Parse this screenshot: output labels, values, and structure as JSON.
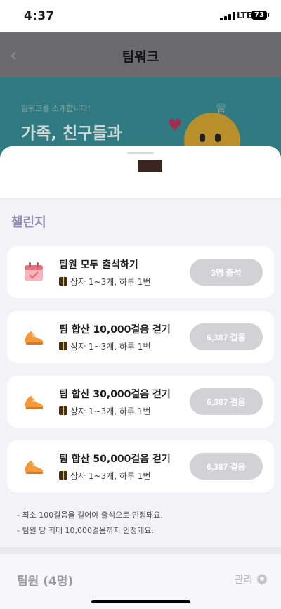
{
  "status": {
    "time": "4:37",
    "network": "LTE",
    "battery": "73"
  },
  "nav": {
    "title": "팀워크",
    "back_icon": "chevron-left-icon"
  },
  "banner": {
    "subtitle": "팀워크를 소개합니다!",
    "title": "가족, 친구들과"
  },
  "section": {
    "title": "챌린지"
  },
  "challenges": [
    {
      "icon": "calendar-icon",
      "title": "팀원 모두 출석하기",
      "reward": "상자 1~3개, 하루 1번",
      "status": "3명 출석"
    },
    {
      "icon": "sneaker-icon",
      "title": "팀 합산 10,000걸음 걷기",
      "reward": "상자 1~3개, 하루 1번",
      "status": "6,387 걸음"
    },
    {
      "icon": "sneaker-icon",
      "title": "팀 합산 30,000걸음 걷기",
      "reward": "상자 1~3개, 하루 1번",
      "status": "6,387 걸음"
    },
    {
      "icon": "sneaker-icon",
      "title": "팀 합산 50,000걸음 걷기",
      "reward": "상자 1~3개, 하루 1번",
      "status": "6,387 걸음"
    }
  ],
  "notes": [
    "- 최소 100걸음을 걸어야 출석으로 인정돼요.",
    "- 팀원 당 최대 10,000걸음까지 인정돼요."
  ],
  "members": {
    "title": "팀원 (4명)",
    "manage_label": "관리",
    "manage_icon": "gear-icon"
  }
}
